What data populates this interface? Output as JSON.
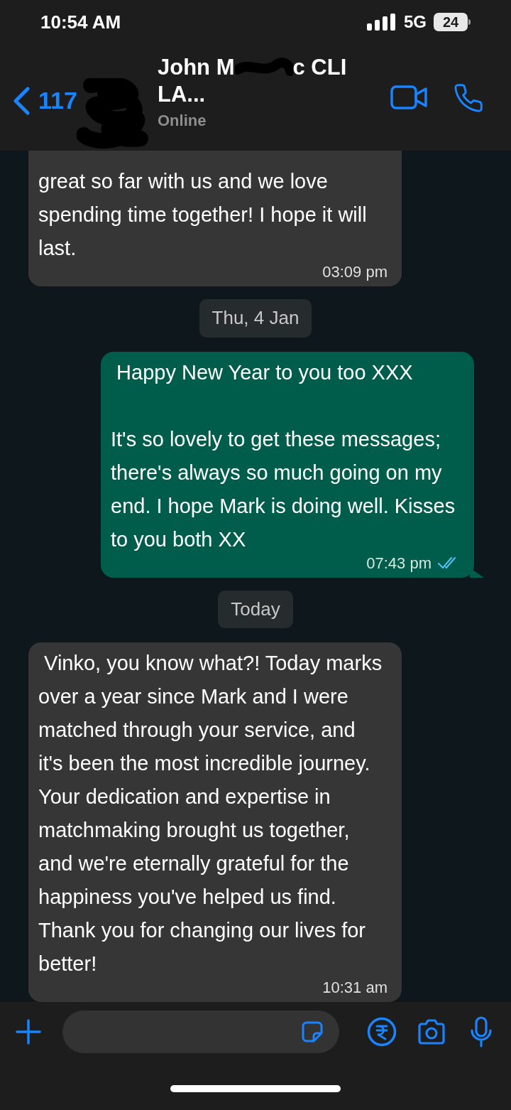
{
  "status_bar": {
    "time": "10:54 AM",
    "network": "5G",
    "battery": "24"
  },
  "header": {
    "back_count": "117",
    "title_start": "John M",
    "title_end": "c CLI",
    "title_line_2": "LA...",
    "presence": "Online"
  },
  "messages": [
    {
      "kind": "incoming",
      "text": "great so far with us and we love spending time together! I hope it will last.",
      "time": "03:09 pm"
    },
    {
      "kind": "date",
      "text": "Thu, 4 Jan"
    },
    {
      "kind": "outgoing",
      "text": " Happy New Year to you too XXX\n\nIt's so lovely to get these messages; there's always so much going on my end. I hope Mark is doing well. Kisses to you both XX",
      "time": "07:43 pm",
      "read": true
    },
    {
      "kind": "date",
      "text": "Today"
    },
    {
      "kind": "incoming",
      "text": " Vinko, you know what?! Today marks over a year since Mark and I were matched through your service, and it's been the most incredible journey. Your dedication and expertise in matchmaking brought us together, and we're eternally grateful for the happiness you've helped us find. Thank you for changing our lives for better!",
      "time": "10:31 am"
    }
  ]
}
